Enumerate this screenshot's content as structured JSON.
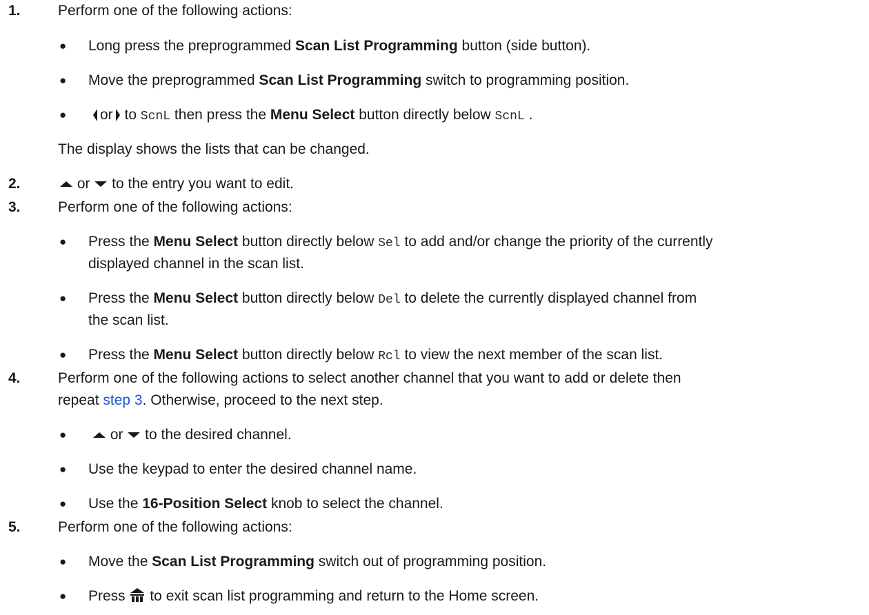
{
  "steps": [
    {
      "number": "1.",
      "intro": "Perform one of the following actions:",
      "bullets": {
        "b1": {
          "pre": "Long press the preprogrammed ",
          "bold": "Scan List Programming",
          "post": " button (side button)."
        },
        "b2": {
          "pre": "Move the preprogrammed ",
          "bold": "Scan List Programming",
          "post": " switch to programming position."
        },
        "b3": {
          "or": "or",
          "to": " to ",
          "code1": "ScnL",
          "mid": " then press the ",
          "bold": "Menu Select",
          "post": " button directly below ",
          "code2": "ScnL",
          "end": " ."
        }
      },
      "after": "The display shows the lists that can be changed."
    },
    {
      "number": "2.",
      "or": " or ",
      "text": " to the entry you want to edit."
    },
    {
      "number": "3.",
      "intro": "Perform one of the following actions:",
      "bullets": [
        {
          "pre": "Press the ",
          "bold": "Menu Select",
          "mid": " button directly below ",
          "code": "Sel",
          "line1": " to add and/or change the priority of the currently",
          "line2": "displayed channel in the scan list."
        },
        {
          "pre": "Press the ",
          "bold": "Menu Select",
          "mid": " button directly below ",
          "code": "Del",
          "line1": " to delete the currently displayed channel from",
          "line2": "the scan list."
        },
        {
          "pre": "Press the ",
          "bold": "Menu Select",
          "mid": " button directly below ",
          "code": "Rcl",
          "line1": " to view the next member of the scan list."
        }
      ]
    },
    {
      "number": "4.",
      "line1": "Perform one of the following actions to select another channel that you want to add or delete then",
      "line2_pre": "repeat ",
      "link": "step 3",
      "line2_post": ". Otherwise, proceed to the next step.",
      "bullets": {
        "b1": {
          "or": " or ",
          "text": " to the desired channel."
        },
        "b2": {
          "text": "Use the keypad to enter the desired channel name."
        },
        "b3": {
          "pre": "Use the ",
          "bold": "16-Position Select",
          "post": " knob to select the channel."
        }
      }
    },
    {
      "number": "5.",
      "intro": "Perform one of the following actions:",
      "bullets": {
        "b1": {
          "pre": "Move the ",
          "bold": "Scan List Programming",
          "post": " switch out of programming position."
        },
        "b2": {
          "pre": "Press ",
          "post": " to exit scan list programming and return to the Home screen."
        }
      }
    }
  ],
  "bullet_glyph": "●",
  "icons": {
    "left": "left-arrow-icon",
    "right": "right-arrow-icon",
    "up": "up-arrow-icon",
    "down": "down-arrow-icon",
    "home": "home-icon"
  },
  "colors": {
    "text": "#1a1a1a",
    "link": "#1a56db"
  }
}
